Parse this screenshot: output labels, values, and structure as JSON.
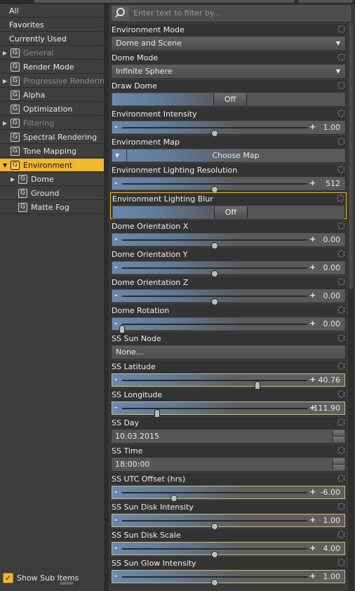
{
  "left_tree": {
    "top_items": [
      "All",
      "Favorites",
      "Currently Used"
    ],
    "items": [
      {
        "label": "General",
        "dim": true,
        "arrow": "▶"
      },
      {
        "label": "Render Mode"
      },
      {
        "label": "Progressive Rendering",
        "dim": true,
        "arrow": "▶"
      },
      {
        "label": "Alpha"
      },
      {
        "label": "Optimization"
      },
      {
        "label": "Filtering",
        "dim": true,
        "arrow": "▶"
      },
      {
        "label": "Spectral Rendering"
      },
      {
        "label": "Tone Mapping"
      },
      {
        "label": "Environment",
        "selected": true,
        "arrow": "▼"
      },
      {
        "label": "Dome",
        "sub": true,
        "arrow": "▶"
      },
      {
        "label": "Ground",
        "sub": true
      },
      {
        "label": "Matte Fog",
        "sub": true
      }
    ],
    "group_icon_glyph": "G",
    "show_sub_items": {
      "label": "Show Sub Items",
      "checked": true,
      "glyph": "✓"
    }
  },
  "filter": {
    "placeholder": "Enter text to filter by..."
  },
  "properties": [
    {
      "title": "Environment Mode",
      "type": "dropdown",
      "value": "Dome and Scene",
      "caret": "▼"
    },
    {
      "title": "Dome Mode",
      "type": "dropdown",
      "value": "Infinite Sphere",
      "caret": "▼"
    },
    {
      "title": "Draw Dome",
      "type": "toggle",
      "value": "Off"
    },
    {
      "title": "Environment Intensity",
      "type": "slider",
      "value": "1.00",
      "fraction": 0.5
    },
    {
      "title": "Environment Map",
      "type": "map",
      "value": "Choose Map",
      "caret": "▼"
    },
    {
      "title": "Environment Lighting Resolution",
      "type": "slider",
      "value": "512",
      "fraction": 0.5
    },
    {
      "title": "Environment Lighting Blur",
      "type": "toggle",
      "value": "Off",
      "highlighted": true
    },
    {
      "title": "Dome Orientation X",
      "type": "slider",
      "value": "0.00",
      "fraction": 0.5
    },
    {
      "title": "Dome Orientation Y",
      "type": "slider",
      "value": "0.00",
      "fraction": 0.5
    },
    {
      "title": "Dome Orientation Z",
      "type": "slider",
      "value": "0.00",
      "fraction": 0.5
    },
    {
      "title": "Dome Rotation",
      "type": "slider",
      "value": "0.00",
      "fraction": 0.0,
      "oval": true
    },
    {
      "title": "SS Sun Node",
      "type": "node",
      "value": "None..."
    },
    {
      "title": "SS Latitude",
      "type": "slider",
      "value": "40.76",
      "fraction": 0.73,
      "oval": true,
      "bright": true
    },
    {
      "title": "SS Longitude",
      "type": "slider",
      "value": "-111.90",
      "fraction": 0.19,
      "oval": true,
      "bright": true
    },
    {
      "title": "SS Day",
      "type": "field",
      "value": "10.03.2015"
    },
    {
      "title": "SS Time",
      "type": "field",
      "value": "18:00:00"
    },
    {
      "title": "SS UTC Offset (hrs)",
      "type": "slider",
      "value": "-6.00",
      "fraction": 0.28,
      "bright": true
    },
    {
      "title": "SS Sun Disk Intensity",
      "type": "slider",
      "value": "1.00",
      "fraction": 0.5,
      "bright": true
    },
    {
      "title": "SS Sun Disk Scale",
      "type": "slider",
      "value": "4.00",
      "fraction": 0.5,
      "bright": true
    },
    {
      "title": "SS Sun Glow Intensity",
      "type": "slider",
      "value": "1.00",
      "fraction": 0.5,
      "bright": true
    }
  ],
  "slider_glyphs": {
    "minus": "-",
    "plus": "+"
  },
  "colors": {
    "accent": "#f0b72f",
    "slider_fill": "#6a88ae",
    "panel": "#3b3b3b"
  }
}
